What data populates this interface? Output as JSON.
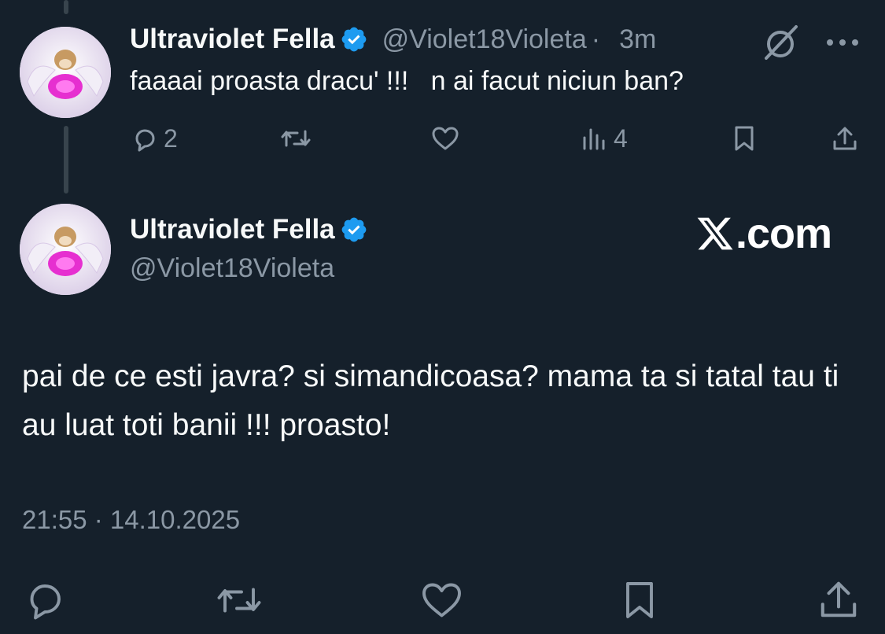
{
  "reply_tweet": {
    "author_name": "Ultraviolet Fella",
    "handle": "@Violet18Violeta",
    "separator": "·",
    "time_ago": "3m",
    "text": "faaaai proasta dracu' !!!   n ai facut niciun ban?",
    "replies": "2",
    "views": "4"
  },
  "main_tweet": {
    "author_name": "Ultraviolet Fella",
    "handle": "@Violet18Violeta",
    "text": "pai de ce esti javra?  si simandicoasa?   mama ta si tatal tau ti au luat toti banii !!!  proasto!",
    "timestamp": "21:55 · 14.10.2025"
  },
  "watermark": ".com",
  "icons": {
    "verified": "verified-badge-icon",
    "grok": "grok-icon",
    "more": "more-icon",
    "reply": "reply-icon",
    "retweet": "retweet-icon",
    "like": "like-icon",
    "views": "views-icon",
    "bookmark": "bookmark-icon",
    "share": "share-icon"
  },
  "colors": {
    "background": "#15202b",
    "text": "#f7f9f9",
    "secondary_text": "#8b98a5",
    "verified_blue": "#1d9bf0",
    "thread_line": "#38444d"
  }
}
